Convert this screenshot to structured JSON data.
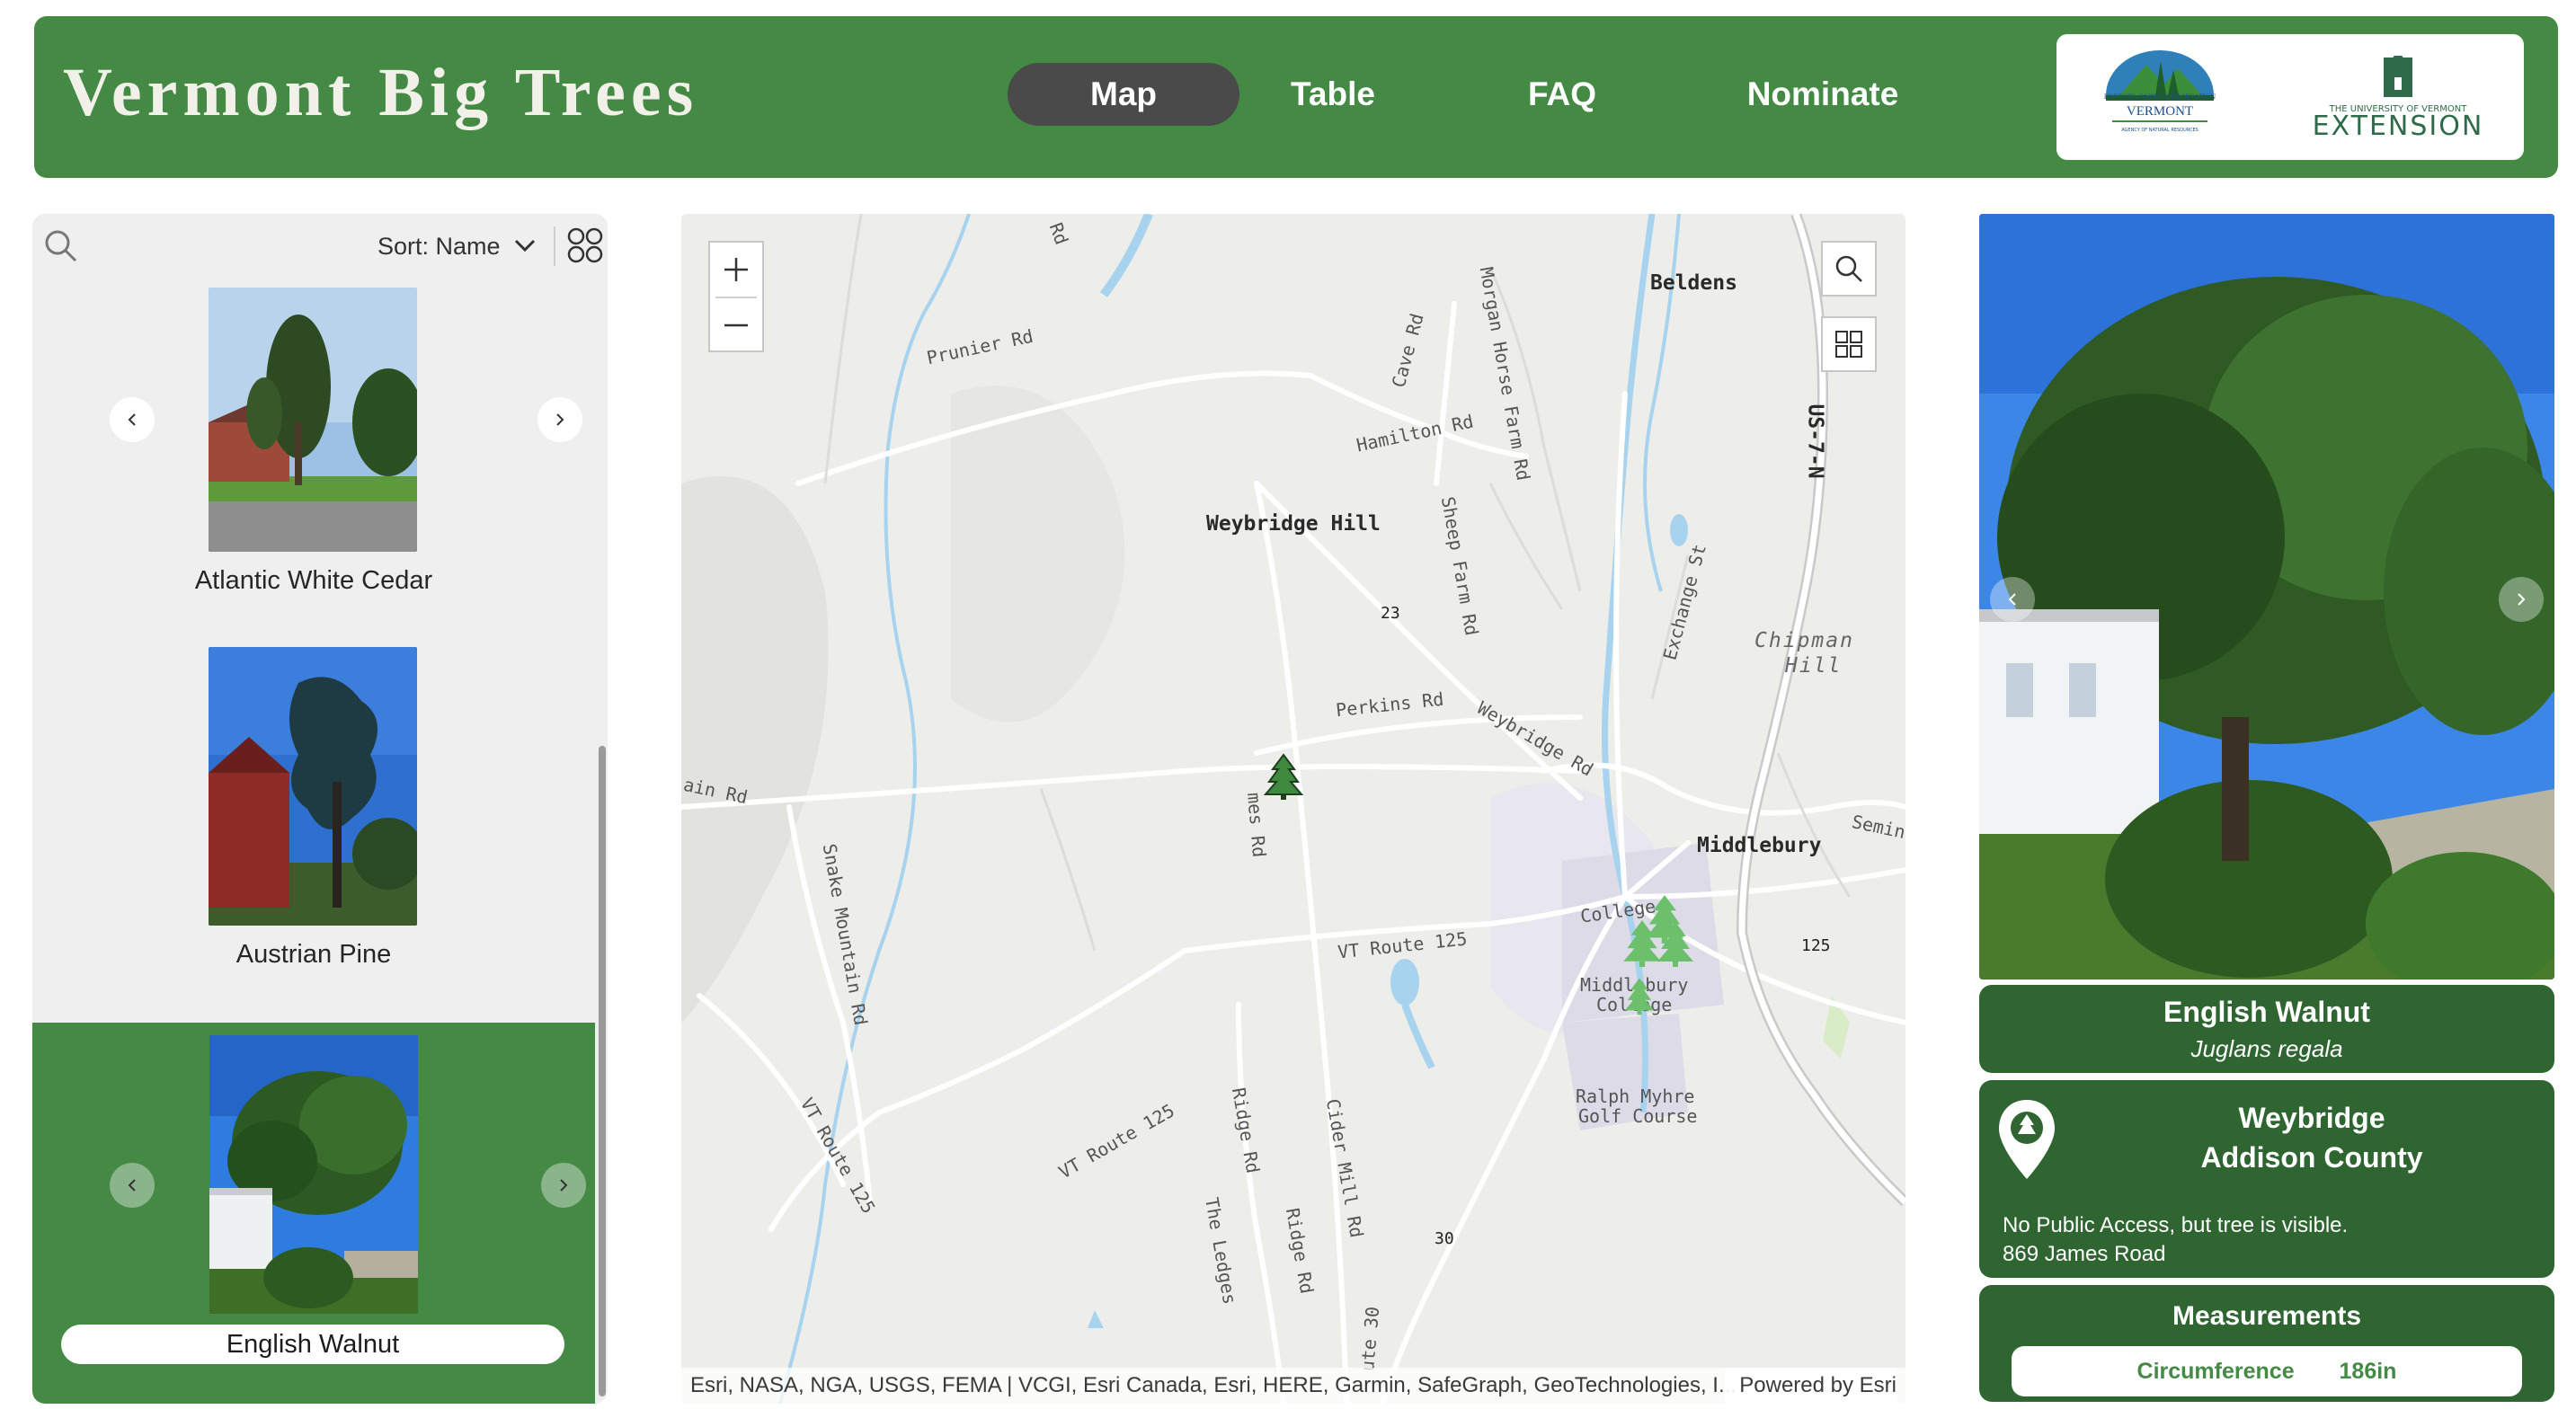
{
  "header": {
    "title": "Vermont Big Trees",
    "nav": [
      "Map",
      "Table",
      "FAQ",
      "Nominate"
    ],
    "active_nav": "Map",
    "logo_vt_text": "VERMONT",
    "logo_vt_top": "FORESTS, PARKS & RECREATION",
    "logo_vt_bottom": "AGENCY OF NATURAL RESOURCES",
    "logo_uvm_top": "THE UNIVERSITY OF VERMONT",
    "logo_uvm_main": "EXTENSION"
  },
  "sidebar": {
    "sort_label": "Sort: Name",
    "items": [
      {
        "name": "Atlantic White Cedar"
      },
      {
        "name": "Austrian Pine"
      },
      {
        "name": "English Walnut",
        "selected": true
      }
    ]
  },
  "map": {
    "labels": {
      "beldens": "Beldens",
      "weybridge_hill": "Weybridge Hill",
      "middlebury": "Middlebury",
      "chipman1": "Chipman",
      "chipman2": "Hill",
      "college": "College",
      "midd_college1": "Middlebury",
      "midd_college2": "College",
      "ralph1": "Ralph Myhre",
      "ralph2": "Golf Course",
      "prunier": "Prunier Rd",
      "hamilton": "Hamilton Rd",
      "cave": "Cave Rd",
      "morgan": "Morgan Horse Farm Rd",
      "sheep": "Sheep Farm Rd",
      "exchange": "Exchange St",
      "us7": "US-7-N",
      "perkins": "Perkins Rd",
      "weybridge_rd": "Weybridge Rd",
      "vt125a": "VT Route 125",
      "vt125b": "VT Route 125",
      "vt125c": "VT Route 125",
      "snake": "Snake Mountain Rd",
      "ridge1": "Ridge Rd",
      "ridge2": "Ridge Rd",
      "cider": "Cider Mill Rd",
      "ledges": "The Ledges",
      "james": "mes Rd",
      "main_rd": "ain Rd",
      "semin": "Semin",
      "rd_top": "Rd",
      "n23": "23",
      "n125": "125",
      "n30": "30",
      "route30": "ute 30"
    },
    "attribution": "Esri, NASA, NGA, USGS, FEMA | VCGI, Esri Canada, Esri, HERE, Garmin, SafeGraph, GeoTechnologies, I...",
    "powered_by": "Powered by Esri"
  },
  "detail": {
    "common_name": "English Walnut",
    "scientific_name": "Juglans  regala",
    "town": "Weybridge",
    "county": "Addison County",
    "access": "No Public Access, but tree is visible.",
    "address": "869 James Road",
    "measurements_title": "Measurements",
    "circumference_label": "Circumference",
    "circumference_value": "186in"
  },
  "colors": {
    "brand_green": "#448a44",
    "dark_green": "#2e6530",
    "active_nav_bg": "#4a4a4a"
  }
}
